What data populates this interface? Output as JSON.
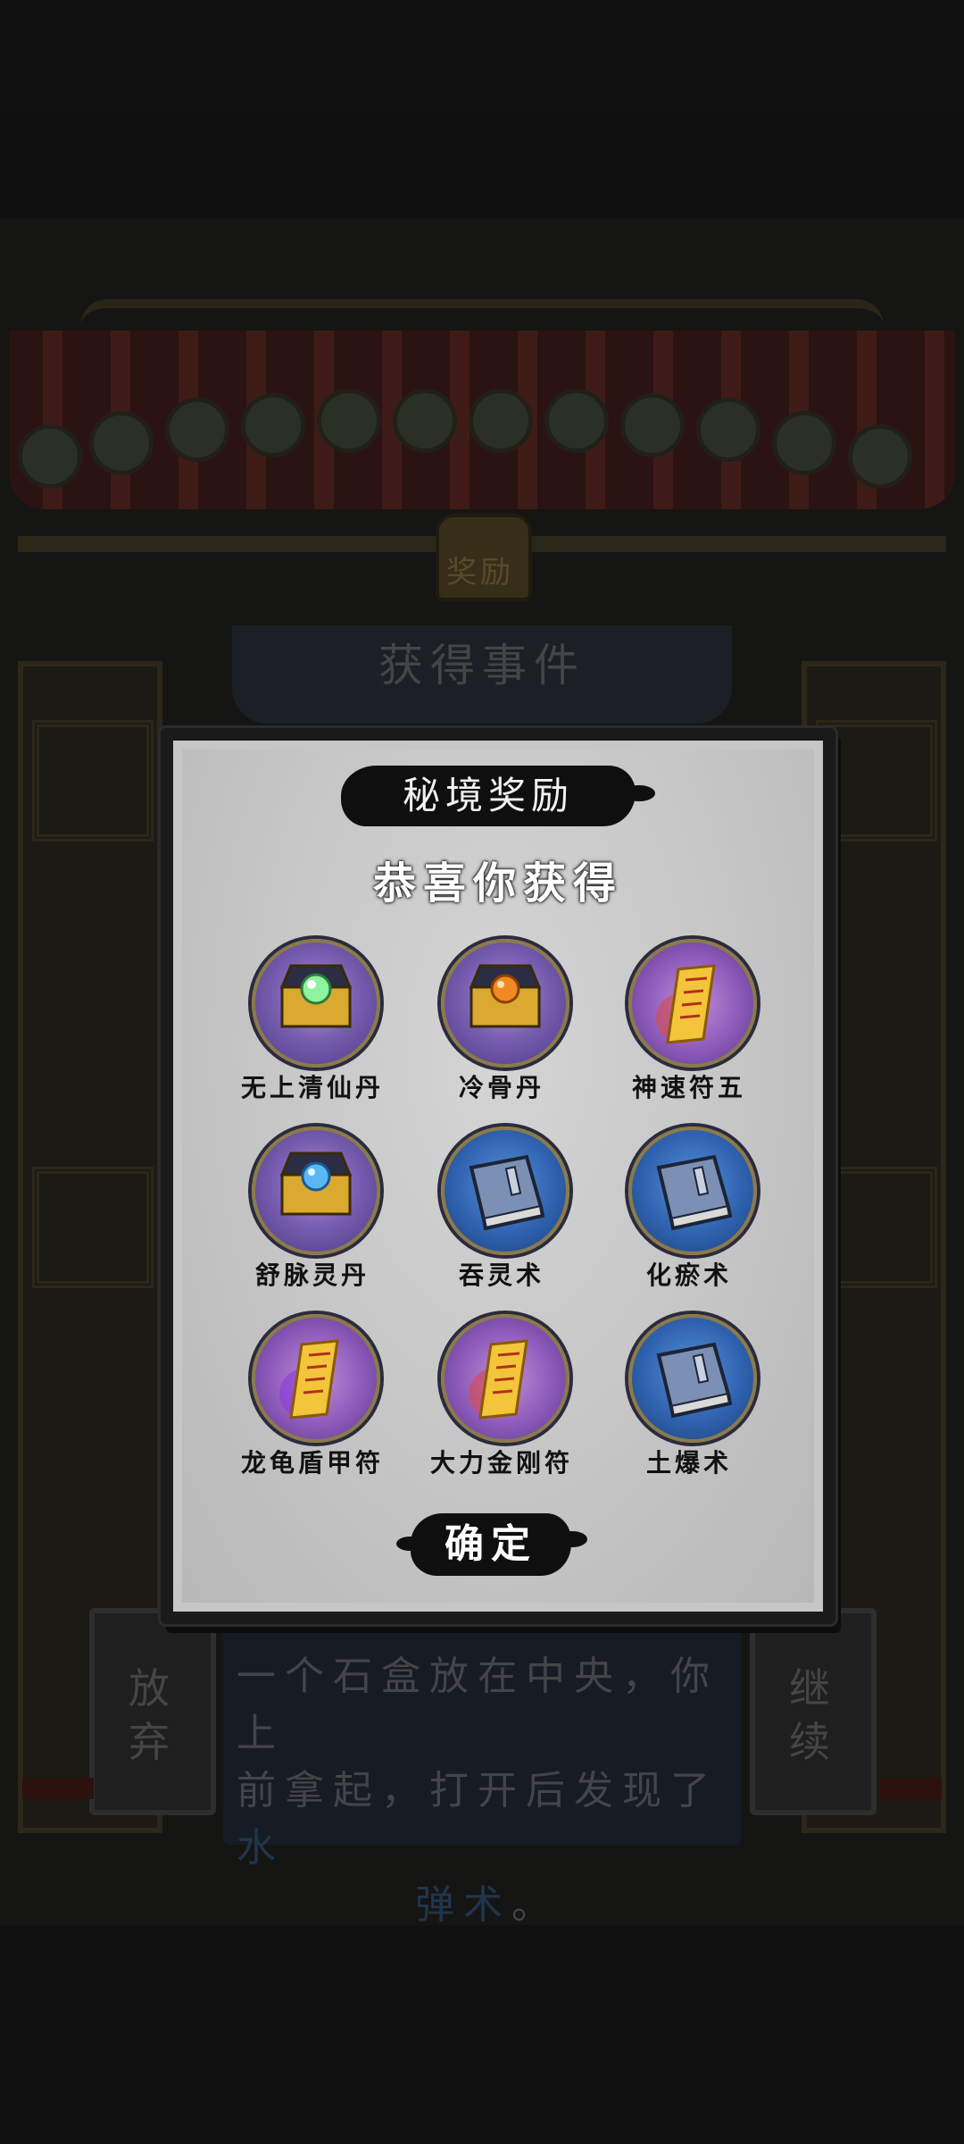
{
  "background": {
    "plaque_text": "奖励",
    "event_title": "获得事件",
    "story_lines": [
      "一个石盒放在中央，你上",
      "前拿起，打开后发现了"
    ],
    "story_highlight_a": "水",
    "story_highlight_b": "弹术",
    "story_end": "。",
    "left_button": "放弃",
    "right_button": "继续"
  },
  "dialog": {
    "title": "秘境奖励",
    "subtitle": "恭喜你获得",
    "confirm_label": "确定",
    "items": [
      {
        "name": "无上清仙丹",
        "icon": "treasure-chest-green-orb-icon",
        "color": "#7a5fb2"
      },
      {
        "name": "冷骨丹",
        "icon": "treasure-chest-orange-orb-icon",
        "color": "#7a5fb2"
      },
      {
        "name": "神速符五",
        "icon": "talisman-scroll-icon",
        "color": "#8d5aba"
      },
      {
        "name": "舒脉灵丹",
        "icon": "treasure-chest-blue-orb-icon",
        "color": "#7a5fb2"
      },
      {
        "name": "吞灵术",
        "icon": "book-icon",
        "color": "#2f63b0"
      },
      {
        "name": "化瘀术",
        "icon": "book-icon",
        "color": "#2f63b0"
      },
      {
        "name": "龙龟盾甲符",
        "icon": "talisman-scroll-icon",
        "color": "#8d5aba"
      },
      {
        "name": "大力金刚符",
        "icon": "talisman-scroll-icon",
        "color": "#8d5aba"
      },
      {
        "name": "土爆术",
        "icon": "book-icon",
        "color": "#2f63b0"
      }
    ]
  }
}
